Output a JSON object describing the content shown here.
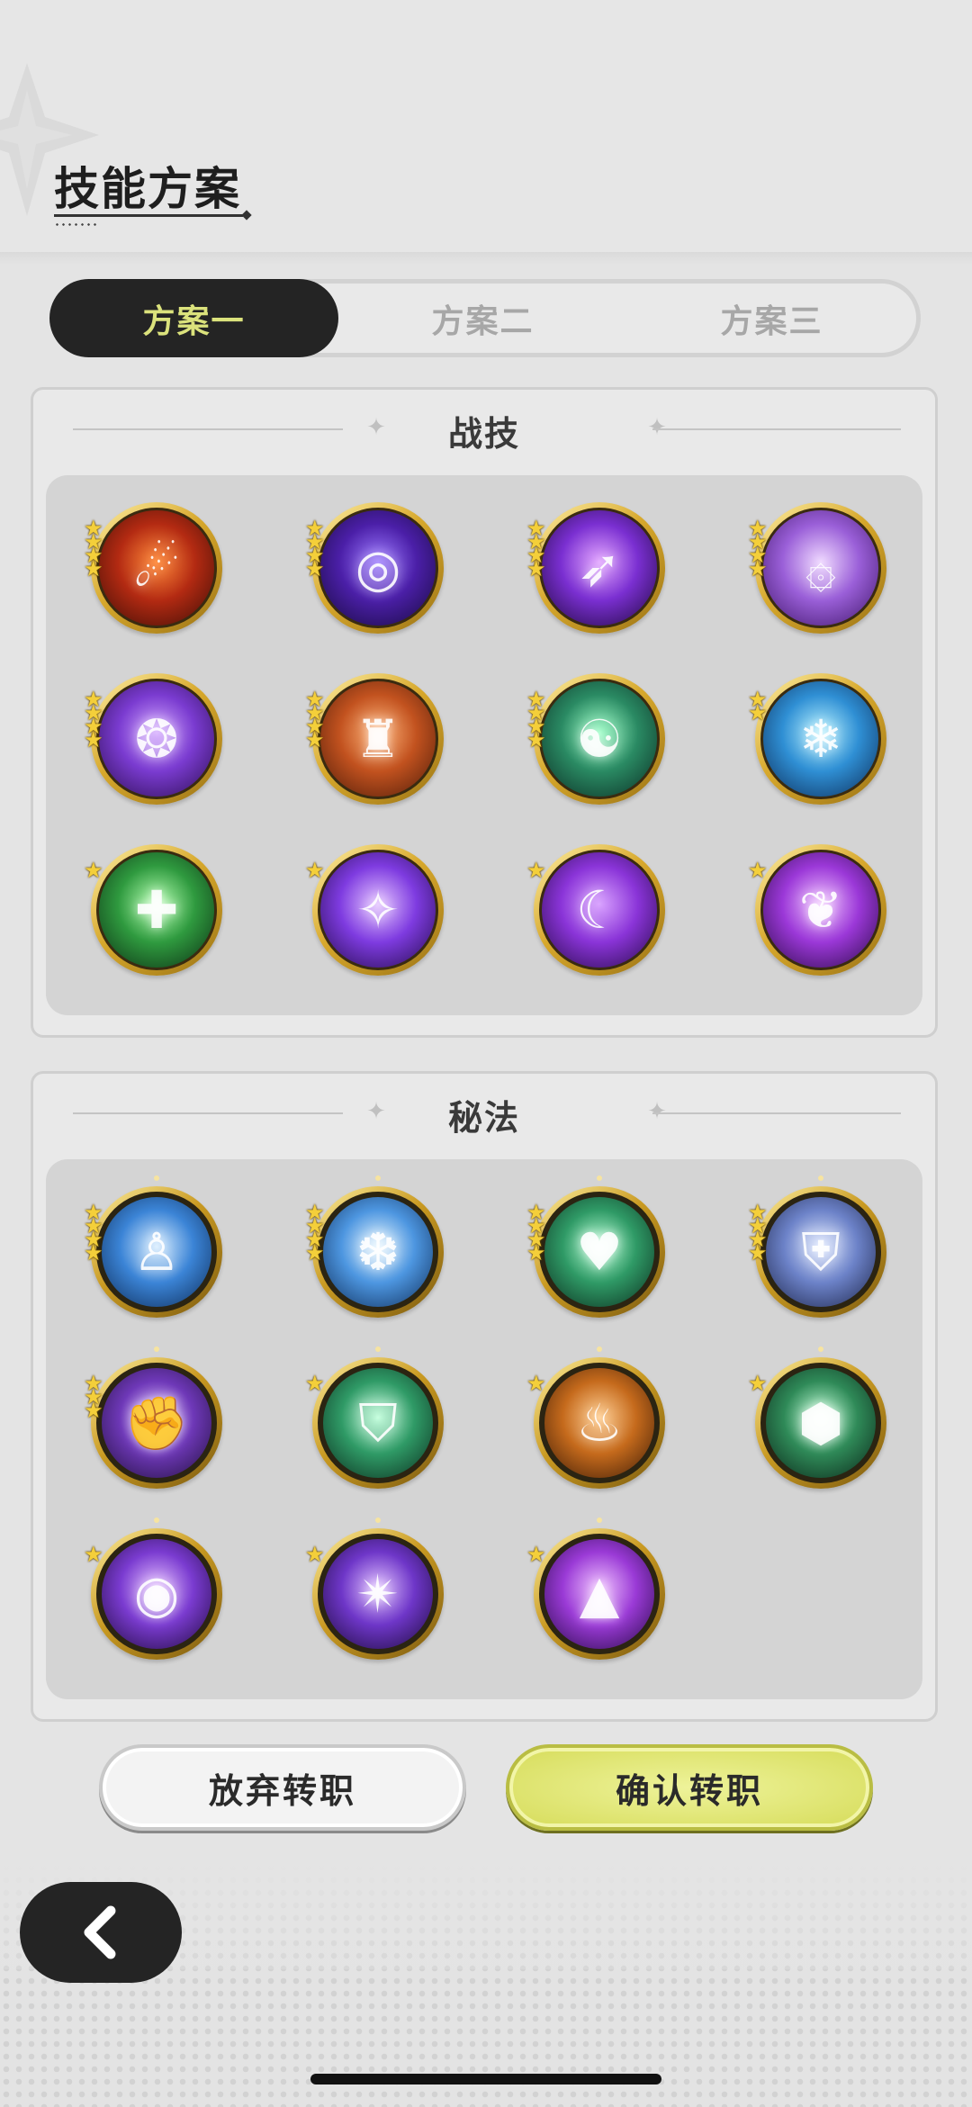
{
  "header": {
    "title": "技能方案"
  },
  "tabs": [
    {
      "label": "方案一",
      "active": true
    },
    {
      "label": "方案二",
      "active": false
    },
    {
      "label": "方案三",
      "active": false
    }
  ],
  "combat_skills": {
    "title": "战技",
    "skills": [
      {
        "icon": "fireball-icon",
        "stars": 4,
        "colors": [
          "#ff8a3a",
          "#b32a12",
          "#3a0d06"
        ]
      },
      {
        "icon": "vortex-icon",
        "stars": 4,
        "colors": [
          "#9d7bff",
          "#4b1fa8",
          "#160a3a"
        ]
      },
      {
        "icon": "arcane-slash-icon",
        "stars": 4,
        "colors": [
          "#e3a6ff",
          "#7a2fd1",
          "#1c0838"
        ]
      },
      {
        "icon": "spiral-shield-icon",
        "stars": 4,
        "colors": [
          "#efd8ff",
          "#9a5fd8",
          "#3d1466"
        ]
      },
      {
        "icon": "purple-ward-icon",
        "stars": 4,
        "colors": [
          "#d3a7ff",
          "#7a3bd0",
          "#2a0d4d"
        ]
      },
      {
        "icon": "stone-golem-icon",
        "stars": 4,
        "colors": [
          "#ffb57a",
          "#c2521f",
          "#4b1a08"
        ]
      },
      {
        "icon": "meditating-spirit-icon",
        "stars": 4,
        "colors": [
          "#9effc8",
          "#2a8a63",
          "#0a2a22"
        ]
      },
      {
        "icon": "ice-guardian-icon",
        "stars": 2,
        "colors": [
          "#b6f2ff",
          "#2f8fd4",
          "#0c2a55"
        ]
      },
      {
        "icon": "healing-plus-icon",
        "stars": 1,
        "colors": [
          "#b4ffb0",
          "#2f9a3f",
          "#0b2b12"
        ]
      },
      {
        "icon": "crystal-star-icon",
        "stars": 1,
        "colors": [
          "#e4c4ff",
          "#7e3be0",
          "#210a45"
        ]
      },
      {
        "icon": "shadow-claw-icon",
        "stars": 1,
        "colors": [
          "#d9a2ff",
          "#8a34d8",
          "#240a44"
        ]
      },
      {
        "icon": "wing-rune-icon",
        "stars": 1,
        "colors": [
          "#f0c2ff",
          "#9b38d8",
          "#2a0a45"
        ]
      }
    ]
  },
  "arcana": {
    "title": "秘法",
    "skills": [
      {
        "icon": "spirit-figure-icon",
        "stars": 4,
        "colors": [
          "#d6ecff",
          "#3b84d6",
          "#0d2a55"
        ]
      },
      {
        "icon": "ice-crystal-icon",
        "stars": 4,
        "colors": [
          "#e6f6ff",
          "#4d96e0",
          "#0e2c58"
        ]
      },
      {
        "icon": "heart-icon",
        "stars": 4,
        "colors": [
          "#b8ffd6",
          "#2f9a66",
          "#0b2b1d"
        ]
      },
      {
        "icon": "armor-plate-icon",
        "stars": 4,
        "colors": [
          "#dce6ff",
          "#6c82c8",
          "#1c2448"
        ]
      },
      {
        "icon": "shadow-fist-icon",
        "stars": 3,
        "colors": [
          "#dec0ff",
          "#6e38b8",
          "#21103b"
        ]
      },
      {
        "icon": "emerald-shield-icon",
        "stars": 1,
        "colors": [
          "#c8ffe0",
          "#2f9a66",
          "#0b2b1d"
        ]
      },
      {
        "icon": "flame-beast-icon",
        "stars": 1,
        "colors": [
          "#ffce92",
          "#c56a1c",
          "#3a1a06"
        ]
      },
      {
        "icon": "jade-boulder-icon",
        "stars": 1,
        "colors": [
          "#c2ffd8",
          "#2f8a58",
          "#0a2418"
        ]
      },
      {
        "icon": "all-seeing-eye-icon",
        "stars": 1,
        "colors": [
          "#e4bfff",
          "#7a3bd0",
          "#1e0a3a"
        ]
      },
      {
        "icon": "rune-star-icon",
        "stars": 1,
        "colors": [
          "#e0c0ff",
          "#6e36c8",
          "#1a0a36"
        ]
      },
      {
        "icon": "arcane-sigil-icon",
        "stars": 1,
        "colors": [
          "#f0c2ff",
          "#9a3ad6",
          "#260a45"
        ]
      }
    ]
  },
  "actions": {
    "cancel_label": "放弃转职",
    "confirm_label": "确认转职"
  }
}
